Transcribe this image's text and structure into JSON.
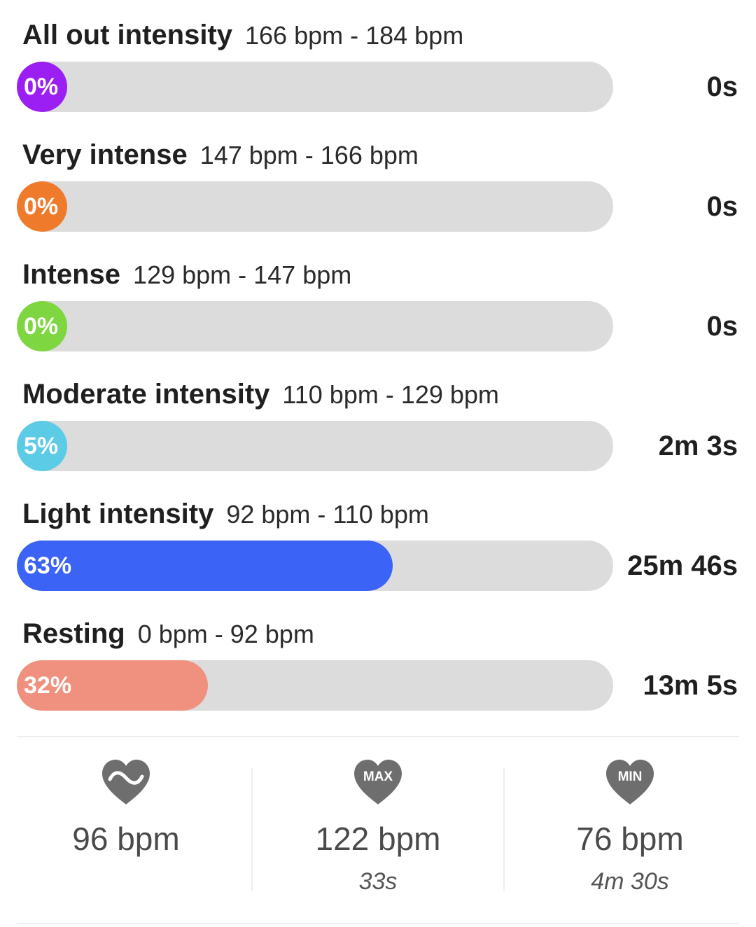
{
  "zones": [
    {
      "name": "All out intensity",
      "range": "166 bpm - 184 bpm",
      "percent_label": "0%",
      "percent": 0,
      "duration": "0s",
      "color": "#9b1ff2"
    },
    {
      "name": "Very intense",
      "range": "147 bpm - 166 bpm",
      "percent_label": "0%",
      "percent": 0,
      "duration": "0s",
      "color": "#f07a2c"
    },
    {
      "name": "Intense",
      "range": "129 bpm - 147 bpm",
      "percent_label": "0%",
      "percent": 0,
      "duration": "0s",
      "color": "#7ed640"
    },
    {
      "name": "Moderate intensity",
      "range": "110 bpm - 129 bpm",
      "percent_label": "5%",
      "percent": 5,
      "duration": "2m 3s",
      "color": "#5ccbe6"
    },
    {
      "name": "Light intensity",
      "range": "92 bpm - 110 bpm",
      "percent_label": "63%",
      "percent": 63,
      "duration": "25m 46s",
      "color": "#3b63f5"
    },
    {
      "name": "Resting",
      "range": "0 bpm - 92 bpm",
      "percent_label": "32%",
      "percent": 32,
      "duration": "13m 5s",
      "color": "#f0917f"
    }
  ],
  "stats": [
    {
      "icon": "heart-average-icon",
      "value": "96 bpm",
      "sub": ""
    },
    {
      "icon": "heart-max-icon",
      "icon_text": "MAX",
      "value": "122 bpm",
      "sub": "33s"
    },
    {
      "icon": "heart-min-icon",
      "icon_text": "MIN",
      "value": "76 bpm",
      "sub": "4m 30s"
    }
  ],
  "colors": {
    "track": "#dcdcdc",
    "heart": "#6e6e6e"
  }
}
